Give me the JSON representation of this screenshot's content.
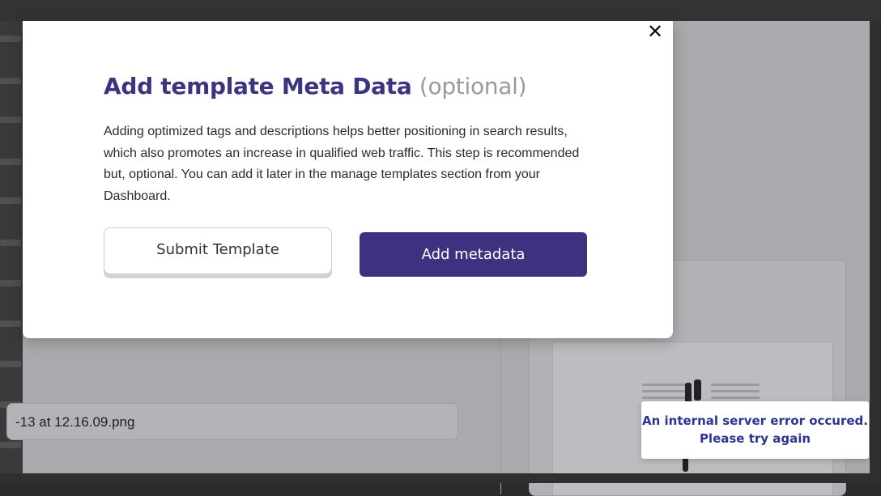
{
  "background": {
    "file_name_value": "-13 at 12.16.09.png"
  },
  "modal": {
    "title_main": "Add template Meta Data",
    "title_optional": "(optional)",
    "description": "Adding optimized tags and descriptions helps better positioning in search results, which also promotes an increase in qualified web traffic. This step is recommended but, optional. You can add it later in the manage templates section from your Dashboard.",
    "submit_label": "Submit Template",
    "add_metadata_label": "Add metadata",
    "close_glyph": "✕",
    "close_icon": "close-icon"
  },
  "toast": {
    "line1": "An internal server error occured.",
    "line2": "Please try again"
  },
  "colors": {
    "brand": "#3c327f",
    "title": "#3b3481",
    "optional": "#9a9a9a",
    "toast_text": "#2d3590"
  }
}
